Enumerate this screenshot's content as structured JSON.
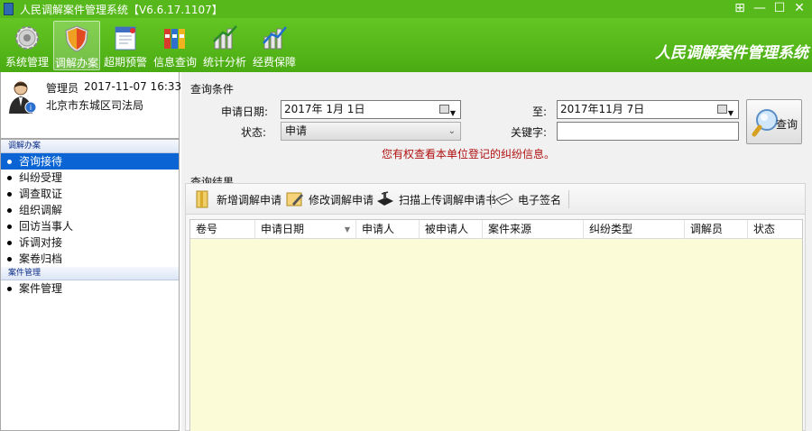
{
  "window": {
    "title": "人民调解案件管理系统【V6.6.17.1107】",
    "buttons": [
      "⊞",
      "—",
      "☐",
      "✕"
    ]
  },
  "ribbon": {
    "tools": [
      {
        "label": "系统管理",
        "icon": "gear-icon"
      },
      {
        "label": "调解办案",
        "icon": "shield-icon"
      },
      {
        "label": "超期预警",
        "icon": "calendar-icon"
      },
      {
        "label": "信息查询",
        "icon": "binders-icon"
      },
      {
        "label": "统计分析",
        "icon": "bar-chart-icon"
      },
      {
        "label": "经费保障",
        "icon": "funding-chart-icon"
      }
    ],
    "brand": "人民调解案件管理系统"
  },
  "user": {
    "name": "管理员",
    "datetime": "2017-11-07 16:33",
    "org": "北京市东城区司法局"
  },
  "sidebar": {
    "groups": [
      {
        "title": "调解办案",
        "items": [
          "咨询接待",
          "纠纷受理",
          "调查取证",
          "组织调解",
          "回访当事人",
          "诉调对接",
          "案卷归档"
        ]
      },
      {
        "title": "案件管理",
        "items": [
          "案件管理"
        ]
      }
    ],
    "selected": "咨询接待"
  },
  "query": {
    "section_label": "查询条件",
    "apply_date_label": "申请日期:",
    "apply_date_from": "2017年  1月  1日",
    "to_label": "至:",
    "apply_date_to": "2017年11月  7日",
    "status_label": "状态:",
    "status_value": "申请",
    "keyword_label": "关键字:",
    "keyword_value": "",
    "notice": "您有权查看本单位登记的纠纷信息。",
    "search_button": "查询"
  },
  "results": {
    "section_label": "查询结果",
    "toolbar": [
      "新增调解申请",
      "修改调解申请",
      "扫描上传调解申请书",
      "电子签名"
    ],
    "columns": [
      "卷号",
      "申请日期",
      "申请人",
      "被申请人",
      "案件来源",
      "纠纷类型",
      "调解员",
      "状态"
    ],
    "rows": []
  }
}
